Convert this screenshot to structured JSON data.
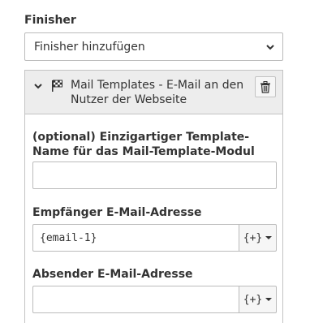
{
  "finisher_section": {
    "label": "Finisher",
    "add_select_value": "Finisher hinzufügen"
  },
  "finisher_panel": {
    "title": "Mail Templates - E-Mail an den Nutzer der Webseite",
    "fields": [
      {
        "label": "(optional) Einzigartiger Template-Name für das Mail-Template-Modul",
        "value": ""
      },
      {
        "label": "Empfänger E-Mail-Adresse",
        "value": "{email-1}",
        "placeholder_button": "{+}"
      },
      {
        "label": "Absender E-Mail-Adresse",
        "value": "",
        "placeholder_button": "{+}"
      }
    ]
  },
  "colors": {
    "header_bg": "#ededed",
    "border": "#c3c3c3",
    "text": "#333333"
  },
  "icons": {
    "collapse": "chevron-down-icon",
    "finisher": "checkered-flag-icon",
    "delete": "trash-icon",
    "select": "chevron-down-icon"
  }
}
